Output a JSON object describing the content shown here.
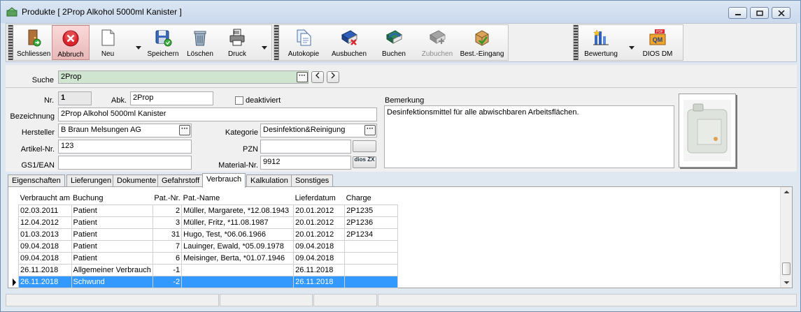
{
  "window": {
    "title": "Produkte [ 2Prop Alkohol 5000ml Kanister ]"
  },
  "toolbar": {
    "group1": [
      {
        "label": "Schliessen",
        "icon": "exit-door-icon"
      },
      {
        "label": "Abbruch",
        "icon": "cancel-icon"
      },
      {
        "label": "Neu",
        "icon": "new-document-icon"
      },
      {
        "label": "Speichern",
        "icon": "save-disk-icon"
      },
      {
        "label": "Löschen",
        "icon": "trash-icon"
      },
      {
        "label": "Druck",
        "icon": "printer-icon"
      }
    ],
    "group2": [
      {
        "label": "Autokopie",
        "icon": "copy-icon"
      },
      {
        "label": "Ausbuchen",
        "icon": "book-out-icon"
      },
      {
        "label": "Buchen",
        "icon": "book-in-icon"
      },
      {
        "label": "Zubuchen",
        "icon": "add-booking-icon"
      },
      {
        "label": "Best.-Eingang",
        "icon": "package-icon"
      }
    ],
    "group3": [
      {
        "label": "Bewertung",
        "icon": "rating-chart-icon"
      },
      {
        "label": "DIOS DM",
        "icon": "dios-dm-icon"
      }
    ]
  },
  "search": {
    "label": "Suche",
    "value": "2Prop"
  },
  "form": {
    "nr_label": "Nr.",
    "nr_value": "1",
    "abk_label": "Abk.",
    "abk_value": "2Prop",
    "deaktiviert_label": "deaktiviert",
    "bezeichnung_label": "Bezeichnung",
    "bezeichnung_value": "2Prop Alkohol 5000ml Kanister",
    "hersteller_label": "Hersteller",
    "hersteller_value": "B Braun Melsungen AG",
    "kategorie_label": "Kategorie",
    "kategorie_value": "Desinfektion&Reinigung",
    "artikel_label": "Artikel-Nr.",
    "artikel_value": "123",
    "pzn_label": "PZN",
    "pzn_value": "",
    "gs1_label": "GS1/EAN",
    "gs1_value": "",
    "material_label": "Material-Nr.",
    "material_value": "9912",
    "dios_btn": "dios ZX",
    "bemerkung_label": "Bemerkung",
    "bemerkung_value": "Desinfektionsmittel für alle abwischbaren Arbeitsflächen."
  },
  "tabs": [
    "Eigenschaften",
    "Lieferungen",
    "Dokumente",
    "Gefahrstoff",
    "Verbrauch",
    "Kalkulation",
    "Sonstiges"
  ],
  "active_tab": "Verbrauch",
  "table": {
    "columns": [
      "Verbraucht am",
      "Buchung",
      "Pat.-Nr.",
      "Pat.-Name",
      "Lieferdatum",
      "Charge"
    ],
    "rows": [
      [
        "02.03.2011",
        "Patient",
        "2",
        "Müller, Margarete, *12.08.1943",
        "20.01.2012",
        "2P1235"
      ],
      [
        "12.04.2012",
        "Patient",
        "3",
        "Müller, Fritz, *11.08.1987",
        "20.01.2012",
        "2P1236"
      ],
      [
        "01.03.2013",
        "Patient",
        "31",
        "Hugo, Test, *06.06.1966",
        "20.01.2012",
        "2P1234"
      ],
      [
        "09.04.2018",
        "Patient",
        "7",
        "Lauinger, Ewald, *05.09.1978",
        "09.04.2018",
        ""
      ],
      [
        "09.04.2018",
        "Patient",
        "6",
        "Meisinger, Berta, *01.07.1946",
        "09.04.2018",
        ""
      ],
      [
        "26.11.2018",
        "Allgemeiner Verbrauch",
        "-1",
        "",
        "26.11.2018",
        ""
      ],
      [
        "26.11.2018",
        "Schwund",
        "-2",
        "",
        "26.11.2018",
        ""
      ]
    ],
    "selected_row": 6
  },
  "colors": {
    "selection": "#3399ff",
    "search_bg": "#cfe5cf",
    "cancel_red": "#d9252b"
  }
}
